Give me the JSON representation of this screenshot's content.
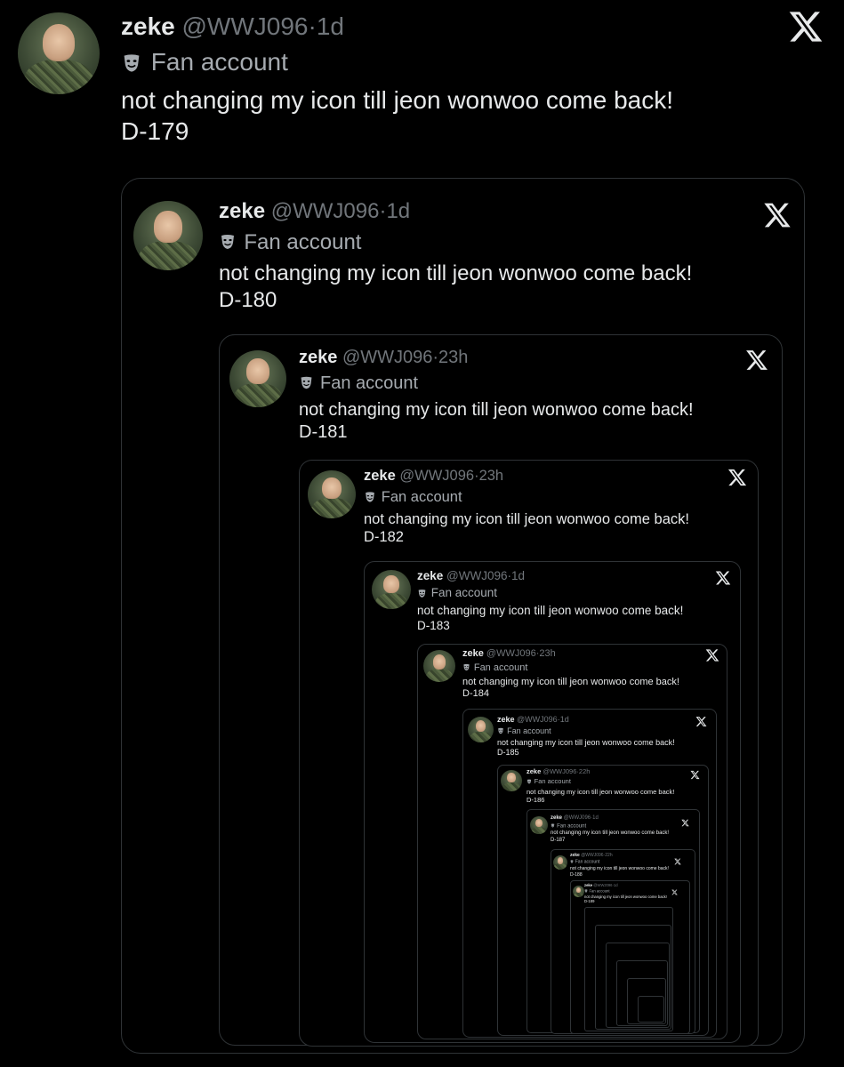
{
  "tweets": [
    {
      "name": "zeke",
      "handle": "@WWJ096",
      "dot": "·",
      "time": "1d",
      "badge": "Fan account",
      "text": "not changing my icon till jeon wonwoo come back!",
      "countdown": "D-179"
    },
    {
      "name": "zeke",
      "handle": "@WWJ096",
      "dot": "·",
      "time": "1d",
      "badge": "Fan account",
      "text": "not changing my icon till jeon wonwoo come back!",
      "countdown": "D-180"
    },
    {
      "name": "zeke",
      "handle": "@WWJ096",
      "dot": "·",
      "time": "23h",
      "badge": "Fan account",
      "text": "not changing my icon till jeon wonwoo come back!",
      "countdown": "D-181"
    },
    {
      "name": "zeke",
      "handle": "@WWJ096",
      "dot": "·",
      "time": "23h",
      "badge": "Fan account",
      "text": "not changing my icon till jeon wonwoo come back!",
      "countdown": "D-182"
    },
    {
      "name": "zeke",
      "handle": "@WWJ096",
      "dot": "·",
      "time": "1d",
      "badge": "Fan account",
      "text": "not changing my icon till jeon wonwoo come back!",
      "countdown": "D-183"
    },
    {
      "name": "zeke",
      "handle": "@WWJ096",
      "dot": "·",
      "time": "23h",
      "badge": "Fan account",
      "text": "not changing my icon till jeon wonwoo come back!",
      "countdown": "D-184"
    },
    {
      "name": "zeke",
      "handle": "@WWJ096",
      "dot": "·",
      "time": "1d",
      "badge": "Fan account",
      "text": "not changing my icon till jeon wonwoo come back!",
      "countdown": "D-185"
    },
    {
      "name": "zeke",
      "handle": "@WWJ096",
      "dot": "·",
      "time": "22h",
      "badge": "Fan account",
      "text": "not changing my icon till jeon wonwoo come back!",
      "countdown": "D-186"
    },
    {
      "name": "zeke",
      "handle": "@WWJ096",
      "dot": "·",
      "time": "1d",
      "badge": "Fan account",
      "text": "not changing my icon till jeon wonwoo come back!",
      "countdown": "D-187"
    },
    {
      "name": "zeke",
      "handle": "@WWJ096",
      "dot": "·",
      "time": "22h",
      "badge": "Fan account",
      "text": "not changing my icon till jeon wonwoo come back!",
      "countdown": "D-188"
    },
    {
      "name": "zeke",
      "handle": "@WWJ096",
      "dot": "·",
      "time": "1d",
      "badge": "Fan account",
      "text": "not changing my icon till jeon wonwoo come back!",
      "countdown": "D-189"
    }
  ],
  "icons": {
    "mask": "theater-mask-icon",
    "close": "x-logo-icon"
  },
  "colors": {
    "background": "#000000",
    "text": "#e7e9ea",
    "muted": "#71767b",
    "border": "#2f3336"
  }
}
